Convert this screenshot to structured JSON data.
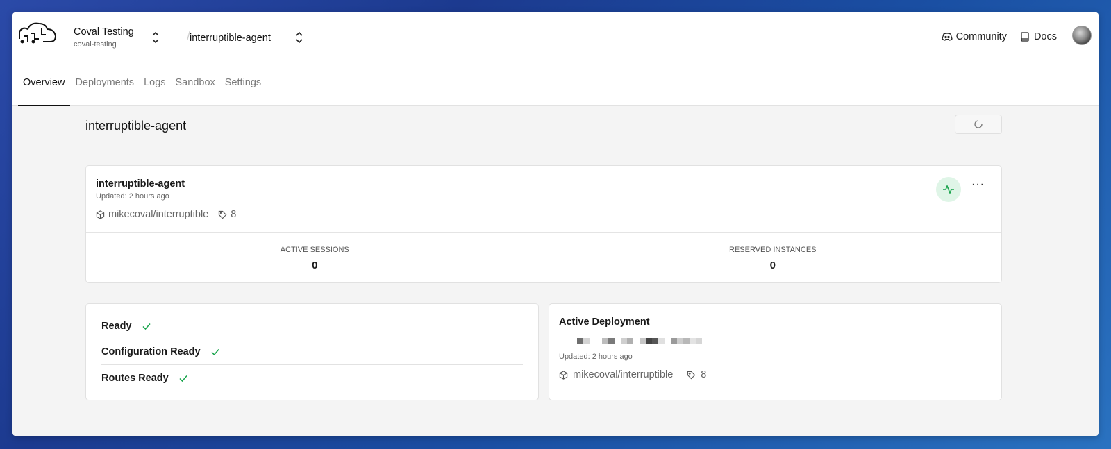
{
  "header": {
    "org_name": "Coval Testing",
    "org_slug": "coval-testing",
    "project_name": "interruptible-agent",
    "links": [
      {
        "label": "Community",
        "icon": "discord-icon"
      },
      {
        "label": "Docs",
        "icon": "book-icon"
      }
    ]
  },
  "tabs": [
    "Overview",
    "Deployments",
    "Logs",
    "Sandbox",
    "Settings"
  ],
  "active_tab": "Overview",
  "page": {
    "title": "interruptible-agent"
  },
  "agent_card": {
    "name": "interruptible-agent",
    "updated": "Updated: 2 hours ago",
    "repo": "mikecoval/interruptible",
    "tag": "8",
    "status_color": "#16a34a",
    "stats": [
      {
        "label": "ACTIVE SESSIONS",
        "value": "0"
      },
      {
        "label": "RESERVED INSTANCES",
        "value": "0"
      }
    ]
  },
  "readiness": [
    {
      "label": "Ready"
    },
    {
      "label": "Configuration Ready"
    },
    {
      "label": "Routes Ready"
    }
  ],
  "active_deployment": {
    "title": "Active Deployment",
    "updated": "Updated: 2 hours ago",
    "repo": "mikecoval/interruptible",
    "tag": "8"
  },
  "colors": {
    "check": "#16a34a",
    "status_bg": "#dff5e7"
  }
}
